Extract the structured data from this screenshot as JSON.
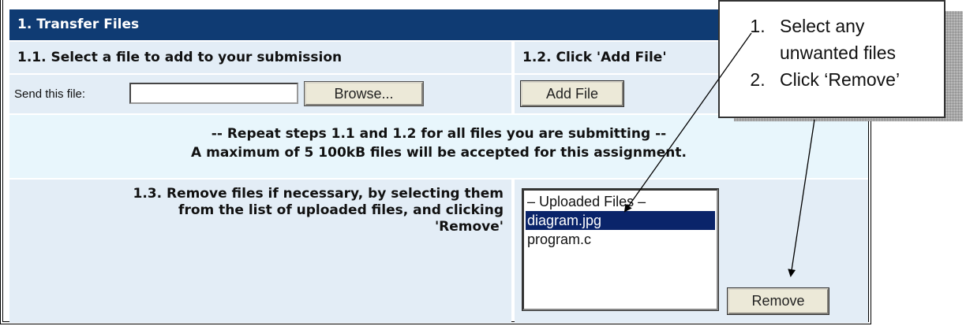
{
  "section": {
    "title": "1. Transfer Files"
  },
  "steps": {
    "select_label": "1.1. Select a file to add to your submission",
    "add_label": "1.2. Click 'Add File'"
  },
  "file_row": {
    "send_label": "Send this file:",
    "file_value": "",
    "browse_label": "Browse...",
    "add_file_label": "Add File"
  },
  "notes": {
    "repeat": "-- Repeat steps 1.1 and 1.2 for all files you are submitting --",
    "maximum": "A maximum of 5 100kB files will be accepted for this assignment."
  },
  "remove_section": {
    "instruction_line1": "1.3. Remove files if necessary, by selecting them",
    "instruction_line2": "from the list of uploaded files, and clicking",
    "instruction_line3": "'Remove'",
    "listbox_items": [
      "– Uploaded Files –",
      "diagram.jpg",
      "program.c"
    ],
    "selected_item": "diagram.jpg",
    "remove_label": "Remove"
  },
  "callout": {
    "steps": [
      "Select any unwanted files",
      "Click ‘Remove’"
    ]
  },
  "colors": {
    "header_bg": "#0f3b73",
    "cell_bg": "#e3edf6",
    "note_bg": "#e8f6fc",
    "selection_bg": "#0a246a",
    "button_face": "#ece9d8"
  }
}
